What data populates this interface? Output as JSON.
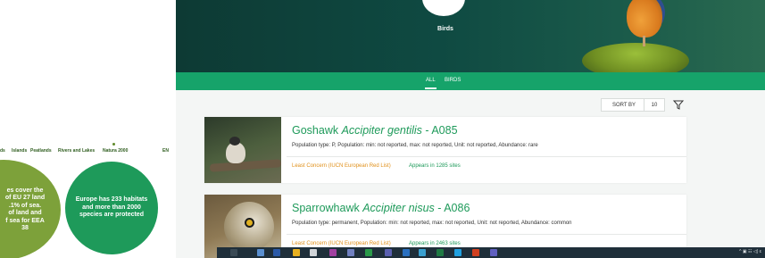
{
  "left_panel": {
    "nav": [
      "ds",
      "Islands",
      "Peatlands",
      "Rivers and Lakes",
      "Natura 2000"
    ],
    "lang": "EN",
    "bubble1": "es cover the\nof EU 27 land\n.1% of sea.\nof land and\nf sea for EEA\n38",
    "bubble2": "Europe has 233 habitats and more than 2000 species are protected"
  },
  "hero": {
    "label": "Birds"
  },
  "tabs": [
    "ALL",
    "BIRDS"
  ],
  "sort": {
    "label": "SORT BY",
    "page_size": "10"
  },
  "cards": [
    {
      "common": "Goshawk ",
      "scientific": "Accipiter gentilis",
      "code": " - A085",
      "description": "Population type: P, Population: min: not reported, max: not reported, Unit: not reported, Abundance: rare",
      "status": "Least Concern (IUCN European Red List)",
      "sites": "Appears in 1285 sites"
    },
    {
      "common": "Sparrowhawk ",
      "scientific": "Accipiter nisus",
      "code": " - A086",
      "description": "Population type: permanent, Population: min: not reported, max: not reported, Unit: not reported, Abundance: common",
      "status": "Least Concern (IUCN European Red List)",
      "sites": "Appears in 2463 sites"
    }
  ],
  "taskbar": {
    "tray": "^ ▣ ☷ ◁) ε"
  },
  "colors": {
    "accent_green": "#1e9a5a",
    "tab_bar": "#16a36a",
    "status_orange": "#e0901a",
    "bubble_olive": "#7da13a"
  }
}
